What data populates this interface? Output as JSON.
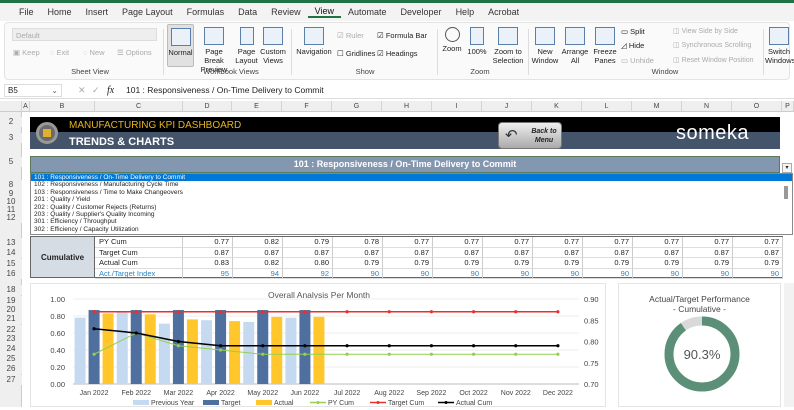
{
  "menu": [
    "File",
    "Home",
    "Insert",
    "Page Layout",
    "Formulas",
    "Data",
    "Review",
    "View",
    "Automate",
    "Developer",
    "Help",
    "Acrobat"
  ],
  "active_menu": "View",
  "ribbon": {
    "sheet_view": {
      "dropdown": "Default",
      "keep": "Keep",
      "exit": "Exit",
      "new": "New",
      "options": "Options",
      "label": "Sheet View"
    },
    "workbook_views": {
      "normal": "Normal",
      "page_break": "Page Break Preview",
      "page_layout": "Page Layout",
      "custom_views": "Custom Views",
      "label": "Workbook Views"
    },
    "show": {
      "navigation": "Navigation",
      "ruler": "Ruler",
      "gridlines": "Gridlines",
      "formula_bar": "Formula Bar",
      "headings": "Headings",
      "label": "Show",
      "ruler_checked": true,
      "gridlines_checked": false,
      "formula_bar_checked": true,
      "headings_checked": true
    },
    "zoom": {
      "zoom": "Zoom",
      "hundred": "100%",
      "zoom_to_selection": "Zoom to Selection",
      "label": "Zoom"
    },
    "window": {
      "new_window": "New Window",
      "arrange_all": "Arrange All",
      "freeze_panes": "Freeze Panes",
      "split": "Split",
      "hide": "Hide",
      "unhide": "Unhide",
      "side_by_side": "View Side by Side",
      "sync_scroll": "Synchronous Scrolling",
      "reset_pos": "Reset Window Position",
      "switch_windows": "Switch Windows",
      "label": "Window"
    }
  },
  "formula_bar": {
    "name_box": "B5",
    "fx": "fx",
    "content": "101 : Responsiveness / On-Time Delivery to Commit"
  },
  "columns": [
    "A",
    "B",
    "C",
    "D",
    "E",
    "F",
    "G",
    "H",
    "I",
    "J",
    "K",
    "L",
    "M",
    "N",
    "O",
    "P"
  ],
  "rows": [
    "2",
    "3",
    "5",
    "8",
    "9",
    "10",
    "11",
    "12",
    "13",
    "14",
    "15",
    "16",
    "18",
    "19",
    "20",
    "21",
    "22",
    "23",
    "24",
    "25",
    "26",
    "27"
  ],
  "header": {
    "title": "MANUFACTURING KPI DASHBOARD",
    "subtitle": "TRENDS & CHARTS",
    "back_button": "Back to Menu",
    "brand": "someka"
  },
  "selector": {
    "value": "101 : Responsiveness / On-Time Delivery to Commit"
  },
  "list_items": [
    "101 : Responsiveness / On-Time Delivery to Commit",
    "102 : Responsiveness / Manufacturing Cycle Time",
    "103 : Responsiveness / Time to Make Changeovers",
    "201 : Quality / Yield",
    "202 : Quality / Customer Rejects (Returns)",
    "203 : Quality / Supplier's Quality Incoming",
    "301 : Efficiency / Throughput",
    "302 : Efficiency / Capacity Utilization"
  ],
  "table": {
    "group_label": "Cumulative",
    "rows": [
      {
        "label": "PY Cum",
        "values": [
          "0.77",
          "0.82",
          "0.79",
          "0.78",
          "0.77",
          "0.77",
          "0.77",
          "0.77",
          "0.77",
          "0.77",
          "0.77",
          "0.77"
        ]
      },
      {
        "label": "Target Cum",
        "values": [
          "0.87",
          "0.87",
          "0.87",
          "0.87",
          "0.87",
          "0.87",
          "0.87",
          "0.87",
          "0.87",
          "0.87",
          "0.87",
          "0.87"
        ]
      },
      {
        "label": "Actual Cum",
        "values": [
          "0.83",
          "0.82",
          "0.80",
          "0.79",
          "0.79",
          "0.79",
          "0.79",
          "0.79",
          "0.79",
          "0.79",
          "0.79",
          "0.79"
        ]
      },
      {
        "label": "Act./Target Index",
        "values": [
          "95",
          "94",
          "92",
          "90",
          "90",
          "90",
          "90",
          "90",
          "90",
          "90",
          "90",
          "90"
        ]
      }
    ]
  },
  "chart_data": [
    {
      "type": "bar+line",
      "title": "Overall Analysis Per Month",
      "categories": [
        "Jan 2022",
        "Feb 2022",
        "Mar 2022",
        "Apr 2022",
        "May 2022",
        "Jun 2022",
        "Jul 2022",
        "Aug 2022",
        "Sep 2022",
        "Oct 2022",
        "Nov 2022",
        "Dec 2022"
      ],
      "y_left": {
        "range": [
          0,
          1
        ],
        "ticks": [
          "1.00",
          "0.80",
          "0.60",
          "0.40",
          "0.20",
          "0.00"
        ]
      },
      "y_right": {
        "range": [
          0.7,
          0.9
        ],
        "ticks": [
          "0.90",
          "0.85",
          "0.80",
          "0.75",
          "0.70"
        ]
      },
      "legend_position": "bottom",
      "series": [
        {
          "name": "Previous Year",
          "kind": "bar",
          "axis": "left",
          "color": "#c5d9f1",
          "values": [
            0.78,
            0.84,
            0.71,
            0.75,
            0.73,
            0.78,
            null,
            null,
            null,
            null,
            null,
            null
          ]
        },
        {
          "name": "Target",
          "kind": "bar",
          "axis": "left",
          "color": "#4f6f9f",
          "values": [
            0.87,
            0.87,
            0.87,
            0.87,
            0.87,
            0.87,
            null,
            null,
            null,
            null,
            null,
            null
          ]
        },
        {
          "name": "Actual",
          "kind": "bar",
          "axis": "left",
          "color": "#ffc72c",
          "values": [
            0.83,
            0.82,
            0.76,
            0.74,
            0.79,
            0.79,
            null,
            null,
            null,
            null,
            null,
            null
          ]
        },
        {
          "name": "PY Cum",
          "kind": "line",
          "axis": "right",
          "color": "#92d050",
          "values": [
            0.77,
            0.82,
            0.79,
            0.78,
            0.77,
            0.77,
            0.77,
            0.77,
            0.77,
            0.77,
            0.77,
            0.77
          ]
        },
        {
          "name": "Target Cum",
          "kind": "line",
          "axis": "right",
          "color": "#e8302f",
          "values": [
            0.87,
            0.87,
            0.87,
            0.87,
            0.87,
            0.87,
            0.87,
            0.87,
            0.87,
            0.87,
            0.87,
            0.87
          ]
        },
        {
          "name": "Actual Cum",
          "kind": "line",
          "axis": "right",
          "color": "#000000",
          "values": [
            0.83,
            0.82,
            0.8,
            0.79,
            0.79,
            0.79,
            0.79,
            0.79,
            0.79,
            0.79,
            0.79,
            0.79
          ]
        }
      ]
    },
    {
      "type": "pie",
      "title": "Actual/Target Performance",
      "subtitle": "- Cumulative -",
      "value": 0.903,
      "label": "90.3%",
      "colors": {
        "fill": "#5b8f77",
        "rest": "#d9d9d9"
      }
    }
  ]
}
